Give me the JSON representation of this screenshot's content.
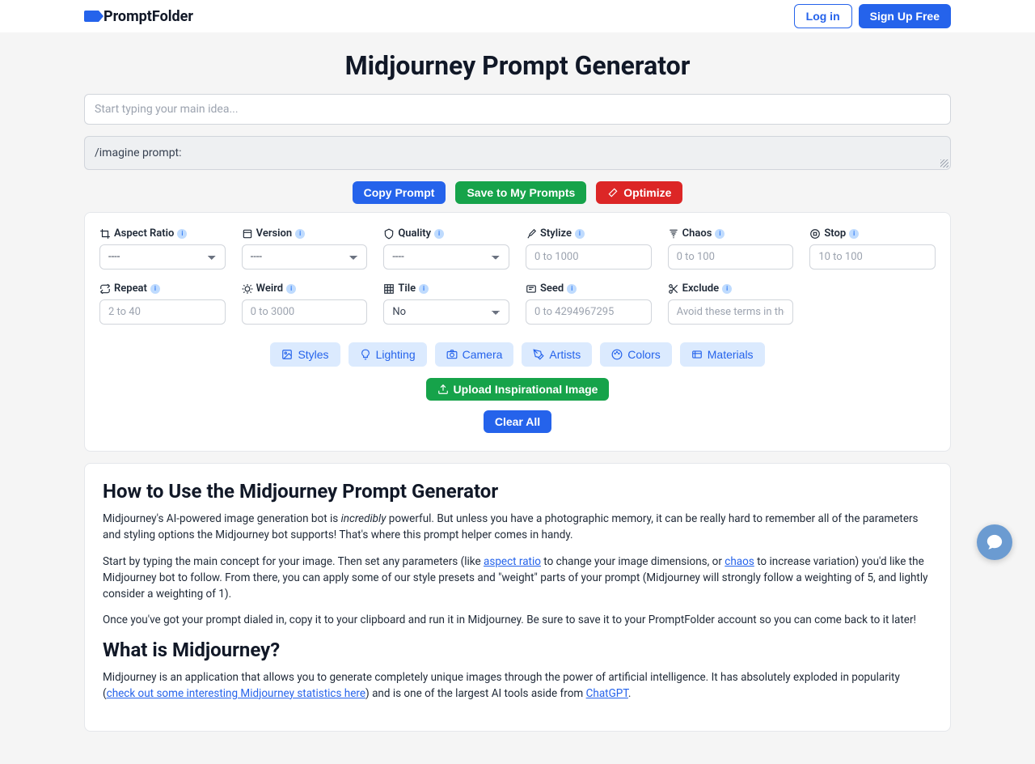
{
  "brand": "PromptFolder",
  "auth": {
    "login": "Log in",
    "signup": "Sign Up Free"
  },
  "title": "Midjourney Prompt Generator",
  "main_input_placeholder": "Start typing your main idea...",
  "output_prefix": "/imagine prompt:",
  "buttons": {
    "copy": "Copy Prompt",
    "save": "Save to My Prompts",
    "optimize": "Optimize"
  },
  "params": {
    "aspect_ratio": {
      "label": "Aspect Ratio",
      "value": "----"
    },
    "version": {
      "label": "Version",
      "value": "----"
    },
    "quality": {
      "label": "Quality",
      "value": "----"
    },
    "stylize": {
      "label": "Stylize",
      "placeholder": "0 to 1000"
    },
    "chaos": {
      "label": "Chaos",
      "placeholder": "0 to 100"
    },
    "stop": {
      "label": "Stop",
      "placeholder": "10 to 100"
    },
    "repeat": {
      "label": "Repeat",
      "placeholder": "2 to 40"
    },
    "weird": {
      "label": "Weird",
      "placeholder": "0 to 3000"
    },
    "tile": {
      "label": "Tile",
      "value": "No"
    },
    "seed": {
      "label": "Seed",
      "placeholder": "0 to 4294967295"
    },
    "exclude": {
      "label": "Exclude",
      "placeholder": "Avoid these terms in the"
    }
  },
  "pills": {
    "styles": "Styles",
    "lighting": "Lighting",
    "camera": "Camera",
    "artists": "Artists",
    "colors": "Colors",
    "materials": "Materials"
  },
  "upload": "Upload Inspirational Image",
  "clear": "Clear All",
  "howto": {
    "heading": "How to Use the Midjourney Prompt Generator",
    "p1a": "Midjourney's AI-powered image generation bot is ",
    "p1em": "incredibly",
    "p1b": " powerful. But unless you have a photographic memory, it can be really hard to remember all of the parameters and styling options the Midjourney bot supports! That's where this prompt helper comes in handy.",
    "p2a": "Start by typing the main concept for your image. Then set any parameters (like ",
    "p2link1": "aspect ratio",
    "p2b": " to change your image dimensions, or ",
    "p2link2": "chaos",
    "p2c": " to increase variation) you'd like the Midjourney bot to follow. From there, you can apply some of our style presets and \"weight\" parts of your prompt (Midjourney will strongly follow a weighting of 5, and lightly consider a weighting of 1).",
    "p3": "Once you've got your prompt dialed in, copy it to your clipboard and run it in Midjourney. Be sure to save it to your PromptFolder account so you can come back to it later!"
  },
  "whatis": {
    "heading": "What is Midjourney?",
    "p1a": "Midjourney is an application that allows you to generate completely unique images through the power of artificial intelligence. It has absolutely exploded in popularity (",
    "p1link": "check out some interesting Midjourney statistics here",
    "p1b": ") and is one of the largest AI tools aside from ",
    "p1link2": "ChatGPT",
    "p1c": "."
  }
}
